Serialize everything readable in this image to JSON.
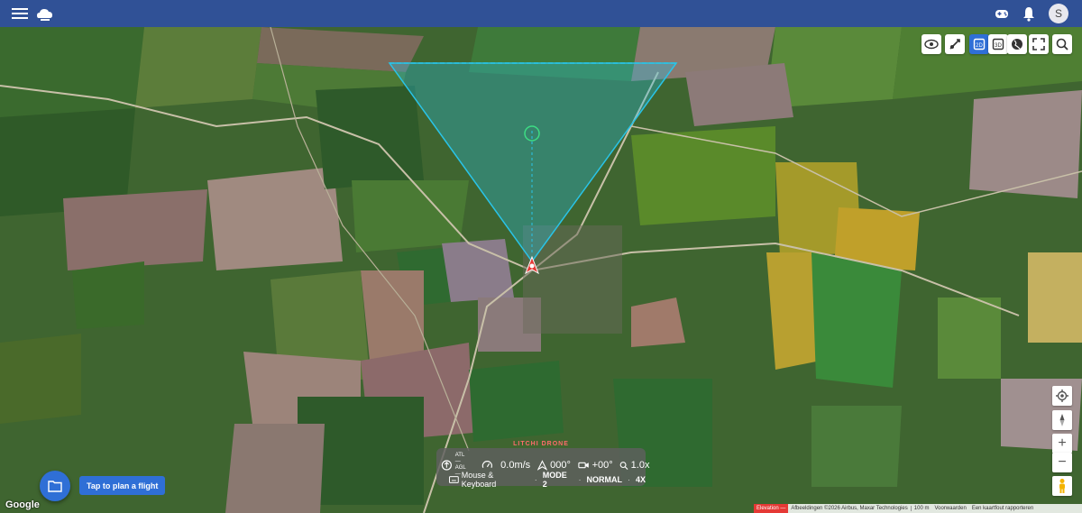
{
  "appbar": {
    "menu_icon": "hamburger-menu-icon",
    "logo_icon": "cloud-logo-icon",
    "gamepad_icon": "gamepad-icon",
    "notifications_icon": "bell-icon",
    "avatar_initial": "S"
  },
  "toolbar": {
    "buttons": [
      "eye-icon",
      "drone-flight-icon",
      "view-2d-icon",
      "view-3d-icon",
      "globe-icon",
      "fullscreen-icon",
      "search-icon"
    ],
    "active": "view-2d-icon"
  },
  "map_controls": {
    "locate_icon": "crosshair-icon",
    "compass_icon": "compass-icon",
    "zoom_in": "+",
    "zoom_out": "−",
    "pegman_icon": "pegman-icon"
  },
  "telemetry": {
    "brand": "LITCHI DRONE",
    "atl_label": "ATL",
    "atl_value": "—",
    "agl_label": "AGL",
    "agl_value": "—",
    "speed": "0.0m/s",
    "heading": "000°",
    "gimbal": "+00°",
    "zoom": "1.0x",
    "input_mode": "Mouse & Keyboard",
    "control_mode": "MODE 2",
    "flight_mode": "NORMAL",
    "speed_mode": "4X"
  },
  "plan": {
    "tooltip": "Tap to plan a flight",
    "icon": "folder-icon"
  },
  "footer": {
    "google": "Google",
    "elevation": "Elevation —",
    "imagery": "Afbeeldingen ©2026 Airbus, Maxar Technologies",
    "scale": "100 m",
    "terms": "Voorwaarden",
    "report": "Een kaartfout rapporteren"
  },
  "colors": {
    "appbar": "#2f4fa0",
    "accent": "#2f6fd6",
    "fov": "#29c4e8",
    "drone": "#e53935"
  }
}
